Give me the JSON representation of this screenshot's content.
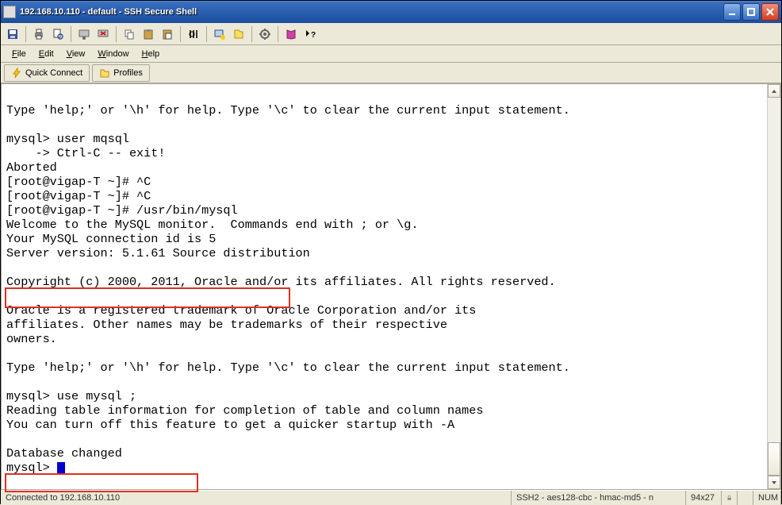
{
  "title": "192.168.10.110 - default - SSH Secure Shell",
  "menu": {
    "file": "File",
    "edit": "Edit",
    "view": "View",
    "window": "Window",
    "help": "Help"
  },
  "quickbar": {
    "quick_connect": "Quick Connect",
    "profiles": "Profiles"
  },
  "terminal": {
    "lines": [
      "",
      "Type 'help;' or '\\h' for help. Type '\\c' to clear the current input statement.",
      "",
      "mysql> user mqsql",
      "    -> Ctrl-C -- exit!",
      "Aborted",
      "[root@vigap-T ~]# ^C",
      "[root@vigap-T ~]# ^C",
      "[root@vigap-T ~]# /usr/bin/mysql",
      "Welcome to the MySQL monitor.  Commands end with ; or \\g.",
      "Your MySQL connection id is 5",
      "Server version: 5.1.61 Source distribution",
      "",
      "Copyright (c) 2000, 2011, Oracle and/or its affiliates. All rights reserved.",
      "",
      "Oracle is a registered trademark of Oracle Corporation and/or its",
      "affiliates. Other names may be trademarks of their respective",
      "owners.",
      "",
      "Type 'help;' or '\\h' for help. Type '\\c' to clear the current input statement.",
      "",
      "mysql> use mysql ;",
      "Reading table information for completion of table and column names",
      "You can turn off this feature to get a quicker startup with -A",
      "",
      "Database changed",
      "mysql> "
    ]
  },
  "status": {
    "connected": "Connected to 192.168.10.110",
    "cipher": "SSH2 - aes128-cbc - hmac-md5 - n",
    "dimensions": "94x27",
    "num": "NUM"
  }
}
